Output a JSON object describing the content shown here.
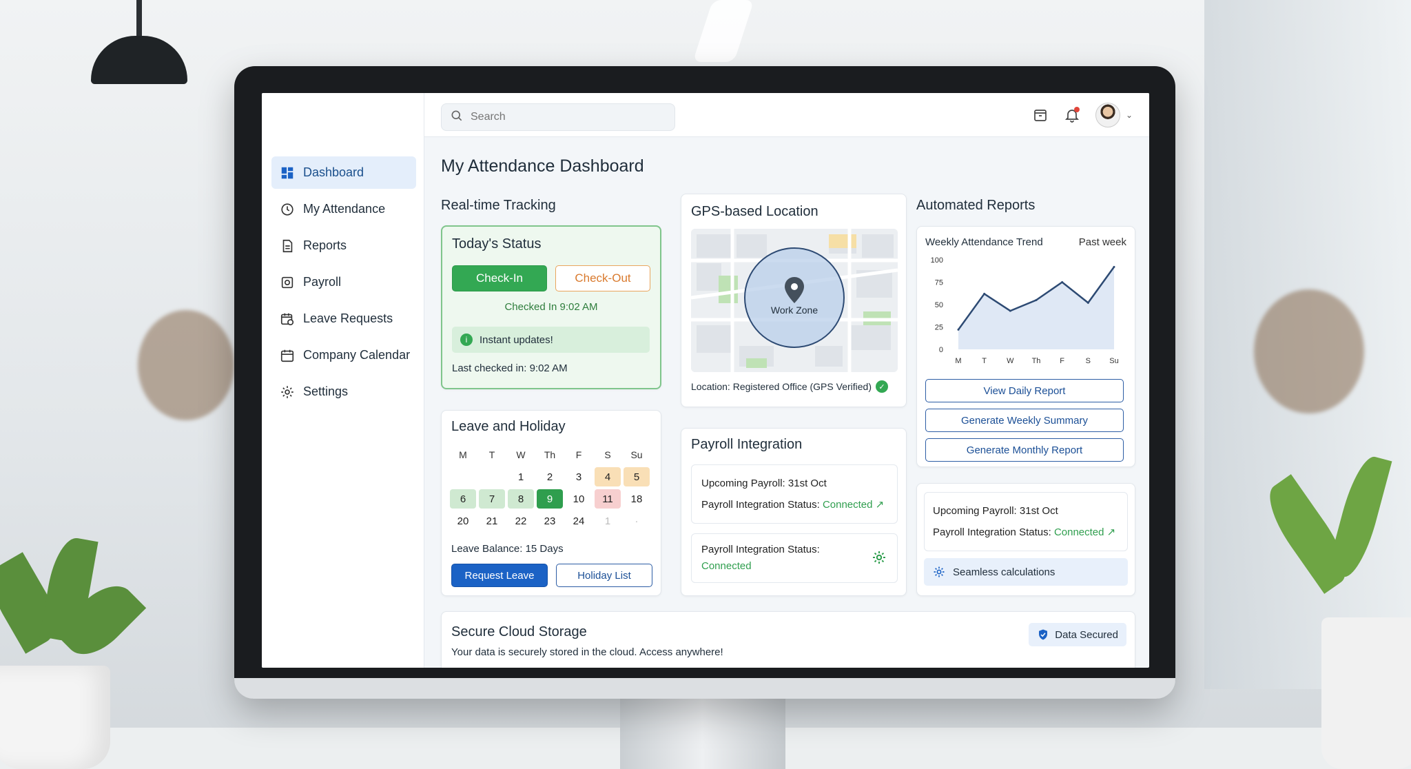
{
  "sidebar": {
    "items": [
      {
        "label": "Dashboard",
        "icon": "dashboard-icon",
        "active": true
      },
      {
        "label": "My Attendance",
        "icon": "clock-icon"
      },
      {
        "label": "Reports",
        "icon": "document-icon"
      },
      {
        "label": "Payroll",
        "icon": "payroll-icon"
      },
      {
        "label": "Leave Requests",
        "icon": "calendar-clock-icon"
      },
      {
        "label": "Company Calendar",
        "icon": "calendar-icon"
      },
      {
        "label": "Settings",
        "icon": "gear-icon"
      }
    ]
  },
  "topbar": {
    "search_placeholder": "Search"
  },
  "page": {
    "title": "My Attendance Dashboard"
  },
  "tracking": {
    "section_title": "Real-time Tracking",
    "card_title": "Today's Status",
    "check_in": "Check-In",
    "check_out": "Check-Out",
    "checked_in": "Checked In 9:02 AM",
    "instant": "Instant updates!",
    "last_checked": "Last checked in: 9:02 AM"
  },
  "leave": {
    "title": "Leave and Holiday",
    "weekdays": [
      "M",
      "T",
      "W",
      "Th",
      "F",
      "S",
      "Su"
    ],
    "days": [
      {
        "t": "",
        "s": ""
      },
      {
        "t": "",
        "s": ""
      },
      {
        "t": "1",
        "s": ""
      },
      {
        "t": "2",
        "s": ""
      },
      {
        "t": "3",
        "s": ""
      },
      {
        "t": "4",
        "s": "orange"
      },
      {
        "t": "5",
        "s": "orange"
      },
      {
        "t": "6",
        "s": "green"
      },
      {
        "t": "7",
        "s": "green"
      },
      {
        "t": "8",
        "s": "green"
      },
      {
        "t": "9",
        "s": "sel"
      },
      {
        "t": "10",
        "s": ""
      },
      {
        "t": "11",
        "s": "red"
      },
      {
        "t": "18",
        "s": ""
      },
      {
        "t": "20",
        "s": ""
      },
      {
        "t": "21",
        "s": ""
      },
      {
        "t": "22",
        "s": ""
      },
      {
        "t": "23",
        "s": ""
      },
      {
        "t": "24",
        "s": ""
      },
      {
        "t": "1",
        "s": "dim"
      },
      {
        "t": "·",
        "s": "dim"
      }
    ],
    "balance": "Leave Balance: 15 Days",
    "request_btn": "Request Leave",
    "holiday_btn": "Holiday List"
  },
  "gps": {
    "title": "GPS-based Location",
    "zone": "Work Zone",
    "location": "Location: Registered Office (GPS Verified)"
  },
  "payroll": {
    "title": "Payroll Integration",
    "upcoming": "Upcoming Payroll: 31st Oct",
    "status_label": "Payroll Integration Status:",
    "status_value": "Connected",
    "status_label2": "Payroll Integration Status:",
    "status_value2": "Connected"
  },
  "reports": {
    "title": "Automated Reports",
    "trend_title": "Weekly Attendance Trend",
    "trend_period": "Past week",
    "view_daily": "View Daily Report",
    "gen_weekly": "Generate Weekly Summary",
    "gen_monthly": "Generate Monthly Report",
    "upcoming": "Upcoming Payroll: 31st Oct",
    "status_label": "Payroll Integration Status:",
    "status_value": "Connected",
    "seamless": "Seamless calculations"
  },
  "storage": {
    "title": "Secure Cloud Storage",
    "desc": "Your data is securely stored in the cloud. Access anywhere!",
    "badge": "Data Secured"
  },
  "chart_data": {
    "type": "area",
    "title": "Weekly Attendance Trend",
    "categories": [
      "M",
      "T",
      "W",
      "Th",
      "F",
      "S",
      "Su"
    ],
    "values": [
      22,
      62,
      43,
      55,
      75,
      52,
      92
    ],
    "ylim": [
      0,
      100
    ],
    "yticks": [
      0,
      25,
      50,
      75,
      100
    ],
    "color": "#2d4a73",
    "grid": false
  },
  "colors": {
    "accent": "#1b62c5",
    "success": "#33a853",
    "warning": "#e9a55d"
  }
}
